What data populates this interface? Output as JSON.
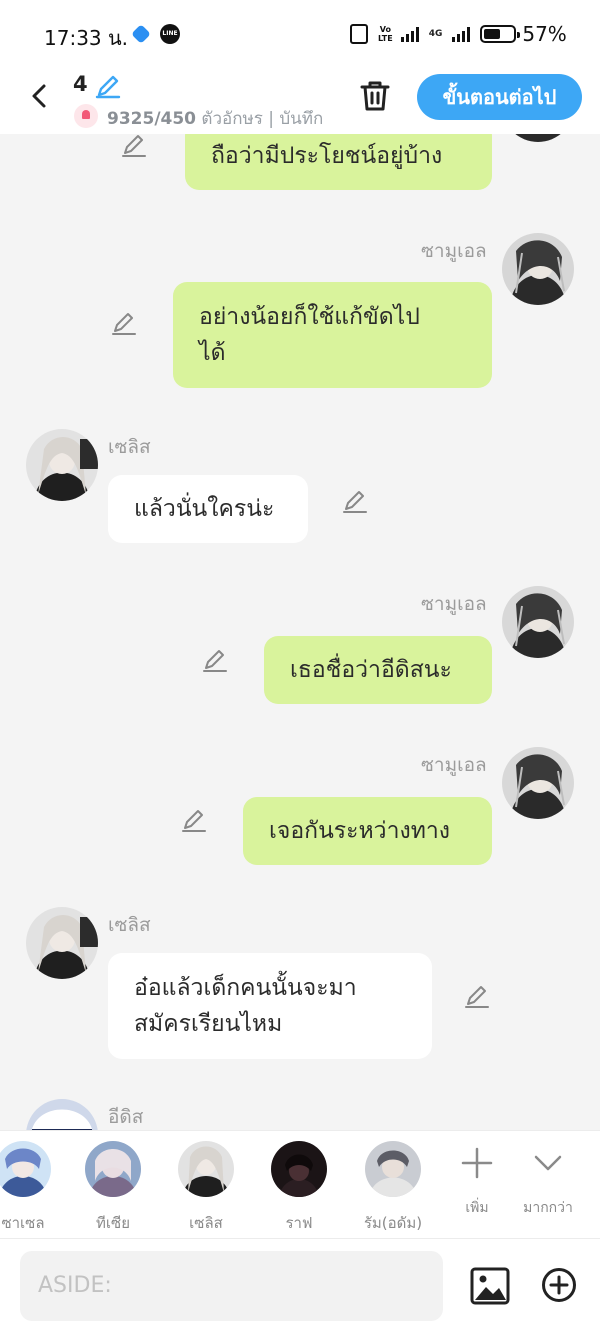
{
  "status_bar": {
    "time": "17:33 น.",
    "volte": "Vo\nLTE",
    "network": "4G",
    "battery_level": 0.57,
    "battery_pct": "57%"
  },
  "header": {
    "episode_number": "4",
    "char_count": "9325/450",
    "count_suffix": " ตัวอักษร | บันทึก",
    "next_label": "ขั้นตอนต่อไป",
    "accent": "#3da7f5"
  },
  "messages": [
    {
      "side": "right",
      "speaker": "",
      "text": "ถือว่ามีประโยชน์อยู่บ้าง"
    },
    {
      "side": "right",
      "speaker": "ซามูเอล",
      "text": "อย่างน้อยก็ใช้แก้ขัดไป\nได้"
    },
    {
      "side": "left",
      "speaker": "เซลิส",
      "text": "แล้วนั่นใครน่ะ"
    },
    {
      "side": "right",
      "speaker": "ซามูเอล",
      "text": "เธอชื่อว่าอีดิสนะ"
    },
    {
      "side": "right",
      "speaker": "ซามูเอล",
      "text": "เจอกันระหว่างทาง"
    },
    {
      "side": "left",
      "speaker": "เซลิส",
      "text": "อ๋อแล้วเด็กคนนั้นจะมา\nสมัครเรียนไหม"
    },
    {
      "side": "left",
      "speaker": "อีดิส",
      "text": ""
    }
  ],
  "characters": [
    {
      "label": "ซาเซล"
    },
    {
      "label": "ทีเซีย"
    },
    {
      "label": "เซลิส"
    },
    {
      "label": "ราฟ"
    },
    {
      "label": "รัม(อดัม)"
    }
  ],
  "utilities": {
    "add_label": "เพิ่ม",
    "more_label": "มากกว่า"
  },
  "input": {
    "placeholder": "ASIDE:"
  },
  "colors": {
    "right_bubble": "#d9f39c",
    "left_bubble": "#ffffff",
    "background": "#f4f4f4"
  }
}
